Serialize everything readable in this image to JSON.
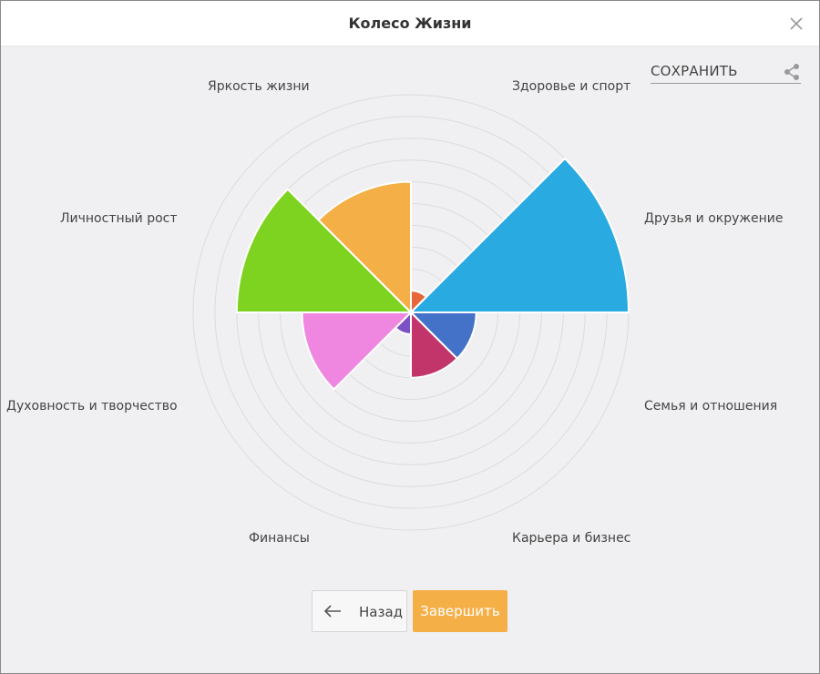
{
  "window": {
    "title": "Колесо Жизни"
  },
  "toolbar": {
    "save_label": "СОХРАНИТЬ"
  },
  "icons": {
    "close": "close-icon",
    "share": "share-icon",
    "back": "arrow-left-icon"
  },
  "footer": {
    "back_label": "Назад",
    "finish_label": "Завершить"
  },
  "chart_data": {
    "type": "polar-area",
    "max": 10,
    "rings": 10,
    "grid": true,
    "sectors": [
      {
        "label": "Здоровье и спорт",
        "value": 1,
        "color": "#e5673a"
      },
      {
        "label": "Друзья и окружение",
        "value": 10,
        "color": "#29aae1"
      },
      {
        "label": "Семья и отношения",
        "value": 3,
        "color": "#4472c9"
      },
      {
        "label": "Карьера и бизнес",
        "value": 3,
        "color": "#c1356a"
      },
      {
        "label": "Финансы",
        "value": 1,
        "color": "#7a52c6"
      },
      {
        "label": "Духовность и творчество",
        "value": 5,
        "color": "#ef87e0"
      },
      {
        "label": "Личностный рост",
        "value": 8,
        "color": "#7ed321"
      },
      {
        "label": "Яркость жизни",
        "value": 6,
        "color": "#f5af47"
      }
    ]
  }
}
